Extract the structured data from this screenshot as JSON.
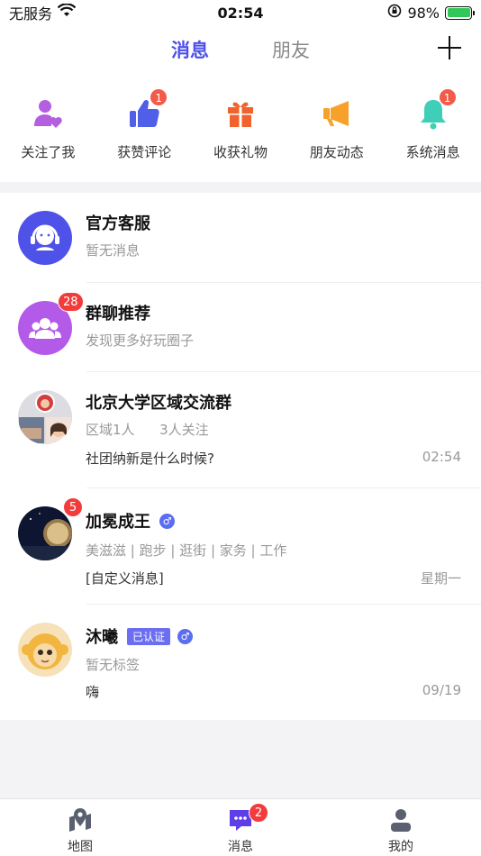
{
  "status_bar": {
    "carrier": "无服务",
    "time": "02:54",
    "battery_percent": "98%"
  },
  "header": {
    "tab_active": "消息",
    "tab_inactive": "朋友"
  },
  "quick_items": [
    {
      "label": "关注了我",
      "icon": "user-heart-icon",
      "color": "#b45ee0",
      "badge": ""
    },
    {
      "label": "获赞评论",
      "icon": "thumbs-up-icon",
      "color": "#4f5fe8",
      "badge": "1"
    },
    {
      "label": "收获礼物",
      "icon": "gift-icon",
      "color": "#f0632e",
      "badge": ""
    },
    {
      "label": "朋友动态",
      "icon": "megaphone-icon",
      "color": "#f7a12b",
      "badge": ""
    },
    {
      "label": "系统消息",
      "icon": "bell-icon",
      "color": "#3fcfb8",
      "badge": "1"
    }
  ],
  "conversations": [
    {
      "title": "官方客服",
      "subtitle": "暂无消息"
    },
    {
      "title": "群聊推荐",
      "subtitle": "发现更多好玩圈子",
      "badge": "28"
    },
    {
      "title": "北京大学区域交流群",
      "subtitle_a": "区域1人",
      "subtitle_b": "3人关注",
      "message": "社团纳新是什么时候?",
      "time": "02:54"
    },
    {
      "title": "加冕成王",
      "gender": "♂",
      "subtitle": "美滋滋 | 跑步 | 逛街 | 家务 | 工作",
      "message": "[自定义消息]",
      "time": "星期一",
      "badge": "5"
    },
    {
      "title": "沐曦",
      "cert": "已认证",
      "gender": "♂",
      "subtitle": "暂无标签",
      "message": "嗨",
      "time": "09/19"
    }
  ],
  "bottom_nav": [
    {
      "label": "地图",
      "icon": "map-pin-icon"
    },
    {
      "label": "消息",
      "icon": "chat-icon",
      "badge": "2"
    },
    {
      "label": "我的",
      "icon": "person-icon"
    }
  ],
  "colors": {
    "accent": "#4f52e8",
    "badge": "#f23c3c"
  }
}
